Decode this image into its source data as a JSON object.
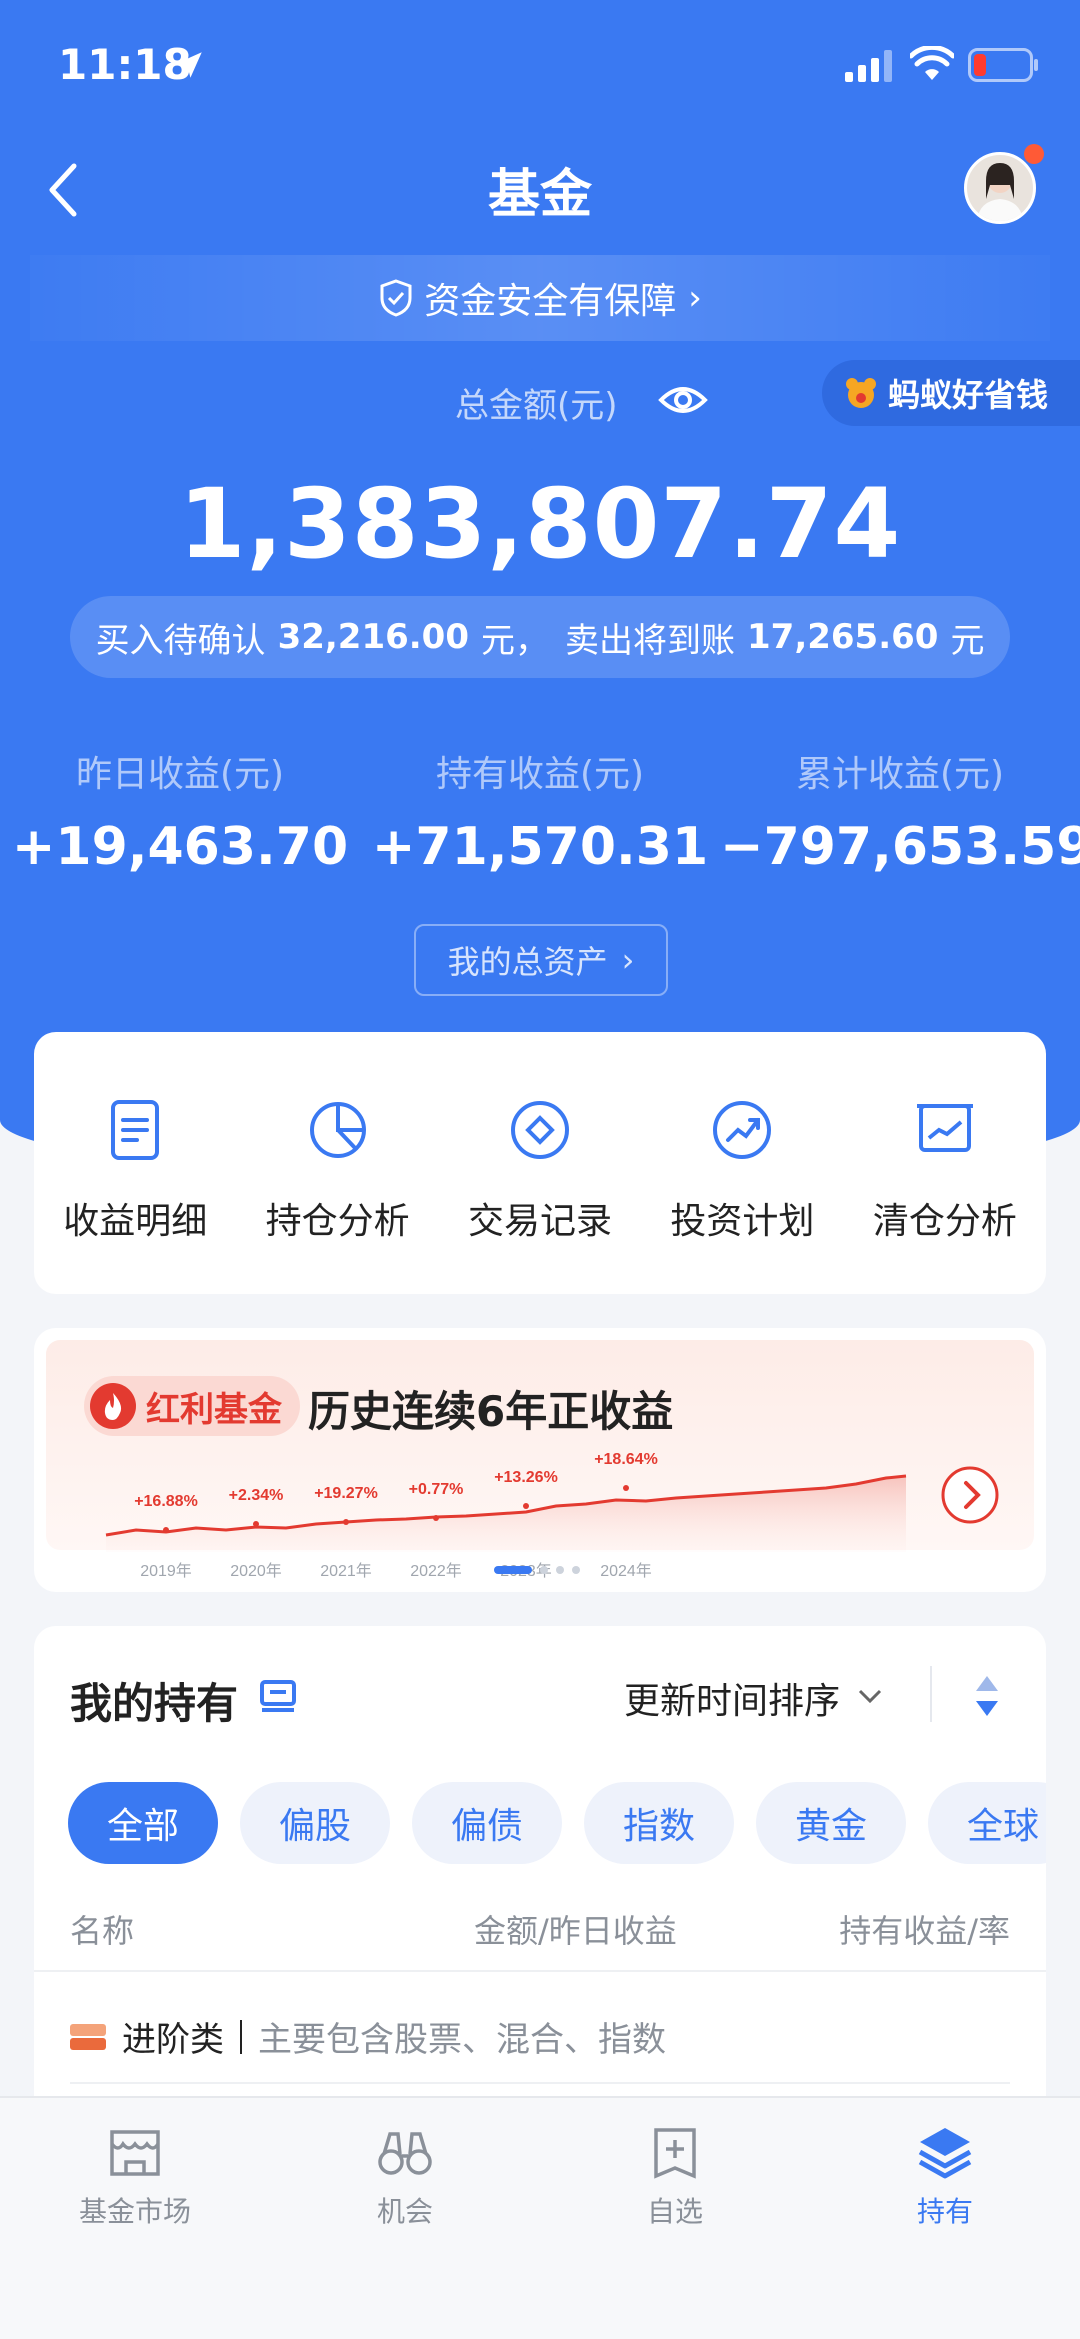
{
  "status_bar": {
    "time": "11:18"
  },
  "nav": {
    "title": "基金"
  },
  "security": {
    "label": "资金安全有保障"
  },
  "promo_tag": {
    "label": "蚂蚁好省钱"
  },
  "total": {
    "label": "总金额(元)",
    "amount": "1,383,807.74"
  },
  "pending": {
    "buy_label": "买入待确认",
    "buy_amount": "32,216.00",
    "buy_unit": "元，",
    "sell_label": "卖出将到账",
    "sell_amount": "17,265.60",
    "sell_unit": "元"
  },
  "earnings": [
    {
      "label": "昨日收益(元)",
      "value": "+19,463.70"
    },
    {
      "label": "持有收益(元)",
      "value": "+71,570.31"
    },
    {
      "label": "累计收益(元)",
      "value": "−797,653.59"
    }
  ],
  "assets_button": {
    "label": "我的总资产"
  },
  "quick_actions": [
    {
      "label": "收益明细",
      "icon": "document-icon"
    },
    {
      "label": "持仓分析",
      "icon": "pie-chart-icon"
    },
    {
      "label": "交易记录",
      "icon": "transaction-icon"
    },
    {
      "label": "投资计划",
      "icon": "growth-icon"
    },
    {
      "label": "清仓分析",
      "icon": "chart-board-icon"
    }
  ],
  "banner": {
    "tag": "红利基金",
    "title": "历史连续6年正收益",
    "years": [
      "2019年",
      "2020年",
      "2021年",
      "2022年",
      "2023年",
      "2024年"
    ],
    "returns": [
      "+16.88%",
      "+2.34%",
      "+19.27%",
      "+0.77%",
      "+13.26%",
      "+18.64%"
    ],
    "page_count": 4,
    "active_page": 0
  },
  "holdings": {
    "title": "我的持有",
    "sort_label": "更新时间排序",
    "chips": [
      "全部",
      "偏股",
      "偏债",
      "指数",
      "黄金",
      "全球"
    ],
    "active_chip": 0,
    "columns": {
      "name": "名称",
      "amount": "金额/昨日收益",
      "return": "持有收益/率"
    },
    "category": {
      "name": "进阶类",
      "desc": "主要包含股票、混合、指数"
    }
  },
  "tabs": [
    {
      "label": "基金市场",
      "icon": "market-icon"
    },
    {
      "label": "机会",
      "icon": "binoculars-icon"
    },
    {
      "label": "自选",
      "icon": "watchlist-icon"
    },
    {
      "label": "持有",
      "icon": "layers-icon"
    }
  ],
  "active_tab": 3,
  "colors": {
    "primary": "#3a79f2",
    "accent_red": "#e33a30",
    "badge": "#ff5a36"
  }
}
